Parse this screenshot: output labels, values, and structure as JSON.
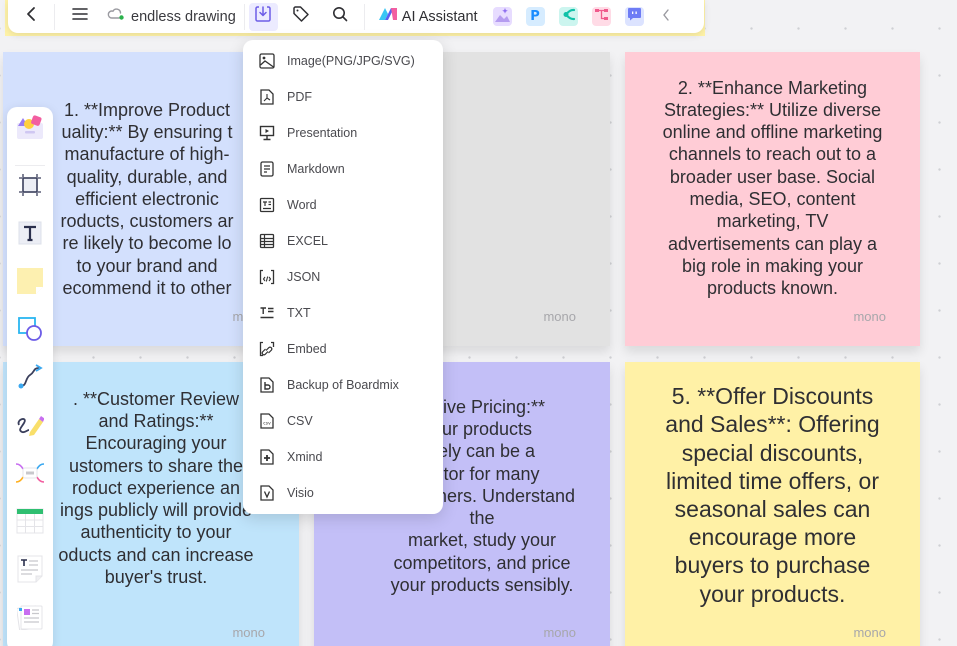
{
  "toolbar": {
    "back_icon": "chevron-left-icon",
    "menu_icon": "hamburger-menu-icon",
    "sync_icon": "cloud-synced-icon",
    "file_title": "endless drawing",
    "export_icon": "download-export-icon",
    "tag_icon": "tag-icon",
    "search_icon": "search-icon",
    "ai_assistant_label": "AI Assistant",
    "apps": [
      {
        "name": "ai-image-app",
        "color": "#c9b5f5"
      },
      {
        "name": "p-app",
        "color": "#d6ecff"
      },
      {
        "name": "mindmap-app",
        "color": "#ccf5ef"
      },
      {
        "name": "flowchart-app",
        "color": "#ffdbe6"
      },
      {
        "name": "chat-app",
        "color": "#dce3ff"
      }
    ],
    "collapse_icon": "chevron-left-icon",
    "active_accent": "#6c5ce7"
  },
  "export_menu": {
    "items": [
      {
        "label": "Image(PNG/JPG/SVG)",
        "icon": "image-icon"
      },
      {
        "label": "PDF",
        "icon": "pdf-file-icon"
      },
      {
        "label": "Presentation",
        "icon": "presentation-icon"
      },
      {
        "label": "Markdown",
        "icon": "markdown-file-icon"
      },
      {
        "label": "Word",
        "icon": "word-file-icon"
      },
      {
        "label": "EXCEL",
        "icon": "excel-table-icon"
      },
      {
        "label": "JSON",
        "icon": "json-file-icon"
      },
      {
        "label": "TXT",
        "icon": "txt-icon"
      },
      {
        "label": "Embed",
        "icon": "embed-link-icon"
      },
      {
        "label": "Backup of Boardmix",
        "icon": "boardmix-backup-icon"
      },
      {
        "label": "CSV",
        "icon": "csv-file-icon"
      },
      {
        "label": "Xmind",
        "icon": "xmind-file-icon"
      },
      {
        "label": "Visio",
        "icon": "visio-file-icon"
      }
    ]
  },
  "left_tools": [
    {
      "name": "templates",
      "icon": "templates-icon"
    },
    {
      "name": "frame",
      "icon": "frame-icon"
    },
    {
      "name": "text",
      "icon": "text-icon"
    },
    {
      "name": "sticky-note",
      "icon": "sticky-note-icon"
    },
    {
      "name": "shapes",
      "icon": "shapes-icon"
    },
    {
      "name": "connector",
      "icon": "connector-line-icon"
    },
    {
      "name": "pen",
      "icon": "pen-draw-icon"
    },
    {
      "name": "mindmap",
      "icon": "mindmap-icon"
    },
    {
      "name": "table",
      "icon": "table-icon"
    },
    {
      "name": "document",
      "icon": "document-icon"
    },
    {
      "name": "cards",
      "icon": "cards-icon"
    }
  ],
  "notes": [
    {
      "color": "#d3e0fd",
      "text": "1. **Improve Product\nuality:** By ensuring t\nmanufacture of high-\nquality, durable, and\nefficient electronic\nroducts, customers ar\nre likely to become lo\nto your brand and\necommend it to other",
      "author": "mono"
    },
    {
      "color": "#e2e2e2",
      "text": "",
      "author": "mono"
    },
    {
      "color": "#ffccd6",
      "text": "2. **Enhance Marketing\nStrategies:** Utilize diverse\nonline and offline marketing\nchannels to reach out to a\nbroader user base. Social\nmedia, SEO, content\nmarketing, TV\nadvertisements can play a\nbig role in making your\nproducts known.",
      "author": "mono"
    },
    {
      "color": "#bfe4fb",
      "text": ". **Customer Review\nand Ratings:**\nEncouraging your\nustomers to share the\nroduct experience an\nings publicly will provide\nauthenticity to your\noducts and can increase\nbuyer's trust.",
      "author": "mono"
    },
    {
      "color": "#c3bff7",
      "text": "etitive Pricing:**\nour products\nvely can be a\nactor for many\ncustomers. Understand the\nmarket, study your\ncompetitors, and price\nyour products sensibly.",
      "author": "mono"
    },
    {
      "color": "#fff1a6",
      "text": "5. **Offer Discounts\nand Sales**: Offering\nspecial discounts,\nlimited time offers, or\nseasonal sales can\nencourage more\nbuyers to purchase\nyour products.",
      "author": "mono"
    }
  ]
}
